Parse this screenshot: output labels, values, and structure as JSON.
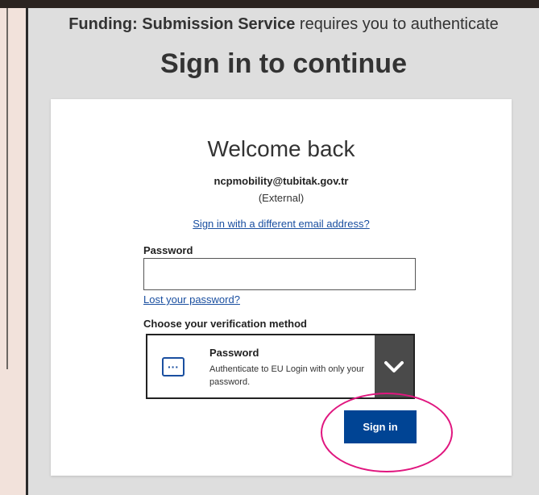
{
  "header": {
    "service_name": "Funding: Submission Service",
    "requires_text": " requires you to authenticate",
    "title": "Sign in to continue"
  },
  "card": {
    "welcome": "Welcome back",
    "email": "ncpmobility@tubitak.gov.tr",
    "account_type": "(External)",
    "different_email_link": "Sign in with a different email address?",
    "password_label": "Password",
    "password_value": "",
    "lost_password_link": "Lost your password?",
    "verification_label": "Choose your verification method",
    "method": {
      "title": "Password",
      "description": "Authenticate to EU Login with only your password.",
      "icon": "password-dots-icon"
    },
    "sign_in_button": "Sign in"
  },
  "colors": {
    "link": "#1a4fa0",
    "primary_button": "#004494",
    "dropdown_bg": "#4a4a4a",
    "annotation_circle": "#e0167f"
  }
}
